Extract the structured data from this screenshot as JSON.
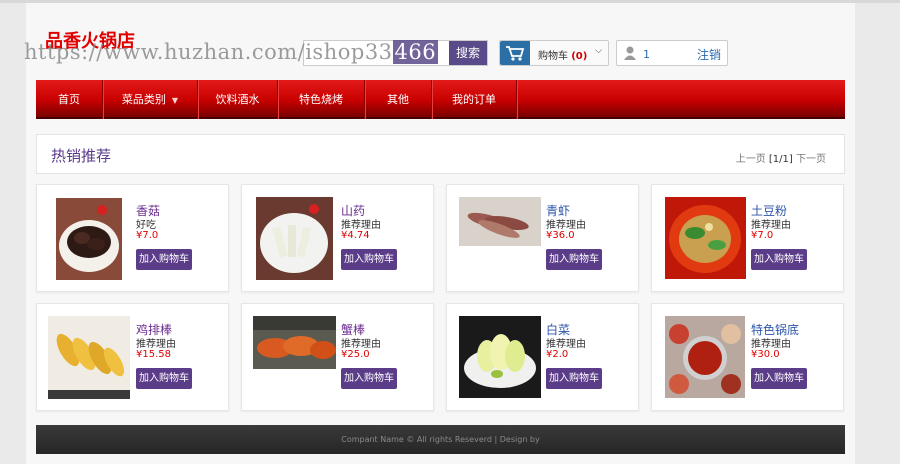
{
  "header": {
    "logo": "品香火锅店",
    "watermark": "https://www.huzhan.com/ishop33466",
    "search_button": "搜索",
    "cart": {
      "label": "购物车",
      "count": "(0)"
    },
    "login": {
      "input_value": "1",
      "link": "注销"
    }
  },
  "nav": {
    "items": [
      {
        "label": "首页"
      },
      {
        "label": "菜品类别",
        "dropdown": true
      },
      {
        "label": "饮料酒水"
      },
      {
        "label": "特色烧烤"
      },
      {
        "label": "其他"
      },
      {
        "label": "我的订单"
      }
    ]
  },
  "panel": {
    "title": "热销推荐",
    "pager": {
      "prev": "上一页",
      "current": "[1/1]",
      "next": "下一页"
    }
  },
  "products": [
    {
      "name": "香菇",
      "desc": "好吃",
      "price": "¥7.0",
      "button": "加入购物车"
    },
    {
      "name": "山药",
      "desc": "推荐理由",
      "price": "¥4.74",
      "button": "加入购物车"
    },
    {
      "name": "青虾",
      "desc": "推荐理由",
      "price": "¥36.0",
      "button": "加入购物车"
    },
    {
      "name": "土豆粉",
      "desc": "推荐理由",
      "price": "¥7.0",
      "button": "加入购物车"
    },
    {
      "name": "鸡排棒",
      "desc": "推荐理由",
      "price": "¥15.58",
      "button": "加入购物车"
    },
    {
      "name": "蟹棒",
      "desc": "推荐理由",
      "price": "¥25.0",
      "button": "加入购物车"
    },
    {
      "name": "白菜",
      "desc": "推荐理由",
      "price": "¥2.0",
      "button": "加入购物车"
    },
    {
      "name": "特色锅底",
      "desc": "推荐理由",
      "price": "¥30.0",
      "button": "加入购物车"
    }
  ],
  "footer": {
    "text": "Compant Name © All rights Reseverd | Design by"
  },
  "colors": {
    "nav_red": "#d00000",
    "brand_purple": "#5b3c88",
    "price_red": "#e00000"
  }
}
